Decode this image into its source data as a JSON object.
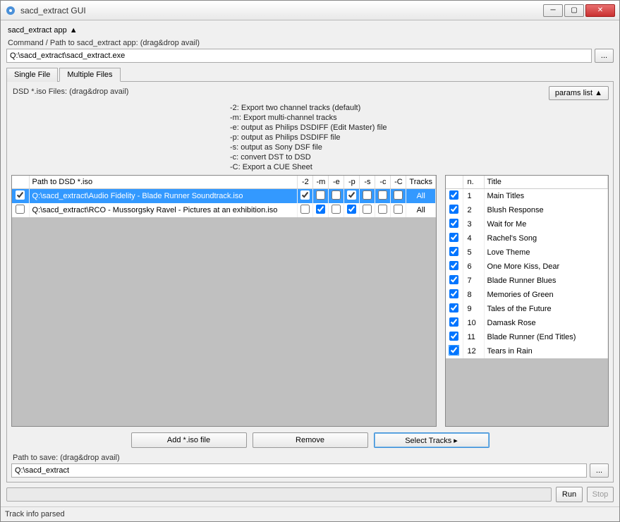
{
  "window": {
    "title": "sacd_extract GUI"
  },
  "sectionHeader": "sacd_extract app",
  "cmdLabel": "Command / Path to sacd_extract app: (drag&drop avail)",
  "cmdPath": "Q:\\sacd_extract\\sacd_extract.exe",
  "tabs": {
    "singleFile": "Single File",
    "multipleFiles": "Multiple Files"
  },
  "dsdLabel": "DSD *.iso Files: (drag&drop avail)",
  "paramsBtn": "params list",
  "options": [
    "-2: Export two channel tracks (default)",
    "-m: Export multi-channel tracks",
    "-e: output as Philips DSDIFF (Edit Master) file",
    "-p: output as Philips DSDIFF file",
    "-s: output as Sony DSF file",
    "-c: convert DST to DSD",
    "-C: Export a CUE Sheet"
  ],
  "leftHeaders": {
    "path": "Path to DSD *.iso",
    "f2": "-2",
    "fm": "-m",
    "fe": "-e",
    "fp": "-p",
    "fs": "-s",
    "fc": "-c",
    "fC": "-C",
    "tracks": "Tracks"
  },
  "files": [
    {
      "sel": true,
      "path": "Q:\\sacd_extract\\Audio Fidelity - Blade Runner Soundtrack.iso",
      "f2": true,
      "fm": false,
      "fe": false,
      "fp": true,
      "fs": false,
      "fc": false,
      "fC": false,
      "tracks": "All"
    },
    {
      "sel": false,
      "path": "Q:\\sacd_extract\\RCO - Mussorgsky Ravel - Pictures at an exhibition.iso",
      "f2": false,
      "fm": true,
      "fe": false,
      "fp": true,
      "fs": false,
      "fc": false,
      "fC": false,
      "tracks": "All"
    }
  ],
  "rightHeaders": {
    "n": "n.",
    "title": "Title"
  },
  "tracks": [
    {
      "chk": true,
      "n": 1,
      "title": "Main Titles"
    },
    {
      "chk": true,
      "n": 2,
      "title": "Blush Response"
    },
    {
      "chk": true,
      "n": 3,
      "title": "Wait for Me"
    },
    {
      "chk": true,
      "n": 4,
      "title": "Rachel's Song"
    },
    {
      "chk": true,
      "n": 5,
      "title": "Love Theme"
    },
    {
      "chk": true,
      "n": 6,
      "title": "One More Kiss, Dear"
    },
    {
      "chk": true,
      "n": 7,
      "title": "Blade Runner Blues"
    },
    {
      "chk": true,
      "n": 8,
      "title": "Memories of Green"
    },
    {
      "chk": true,
      "n": 9,
      "title": "Tales of the Future"
    },
    {
      "chk": true,
      "n": 10,
      "title": "Damask Rose"
    },
    {
      "chk": true,
      "n": 11,
      "title": "Blade Runner (End Titles)"
    },
    {
      "chk": true,
      "n": 12,
      "title": "Tears in Rain"
    }
  ],
  "buttons": {
    "addIso": "Add *.iso file",
    "remove": "Remove",
    "selectTracks": "Select Tracks ▸",
    "run": "Run",
    "stop": "Stop",
    "browse": "..."
  },
  "saveLabel": "Path to save: (drag&drop avail)",
  "savePath": "Q:\\sacd_extract",
  "status": "Track info parsed"
}
